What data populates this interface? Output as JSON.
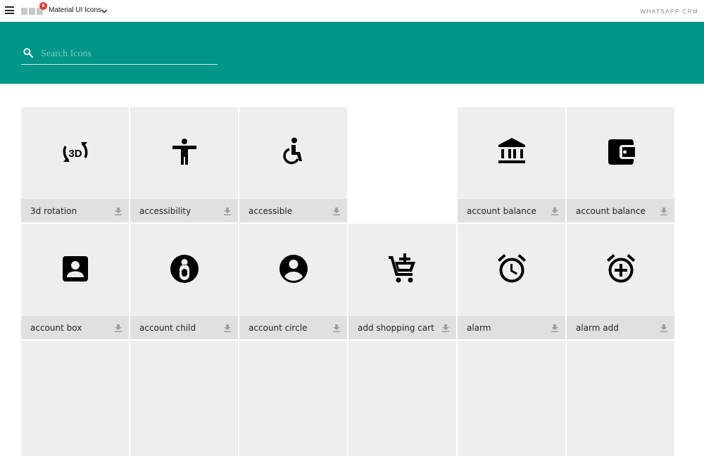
{
  "app": {
    "title": "Material UI Icons",
    "badge_count": "6",
    "brand": "WHATSAPP CRM"
  },
  "search": {
    "placeholder": "Search Icons",
    "value": ""
  },
  "colors": {
    "header": "#009688",
    "tile": "#eeeeee",
    "tile_bar": "#e0e0e0",
    "badge": "#e53935"
  },
  "icons": [
    {
      "label": "3d rotation",
      "icon": "3d-rotation-icon"
    },
    {
      "label": "accessibility",
      "icon": "accessibility-icon"
    },
    {
      "label": "accessible",
      "icon": "accessible-icon"
    },
    {
      "label": "account balance",
      "icon": "account-balance-icon"
    },
    {
      "label": "account balance",
      "icon": "account-balance-wallet-icon"
    },
    {
      "label": "account box",
      "icon": "account-box-icon"
    },
    {
      "label": "account child",
      "icon": "account-child-icon"
    },
    {
      "label": "account circle",
      "icon": "account-circle-icon"
    },
    {
      "label": "add shopping cart",
      "icon": "add-shopping-cart-icon"
    },
    {
      "label": "alarm",
      "icon": "alarm-icon"
    },
    {
      "label": "alarm add",
      "icon": "alarm-add-icon"
    }
  ]
}
